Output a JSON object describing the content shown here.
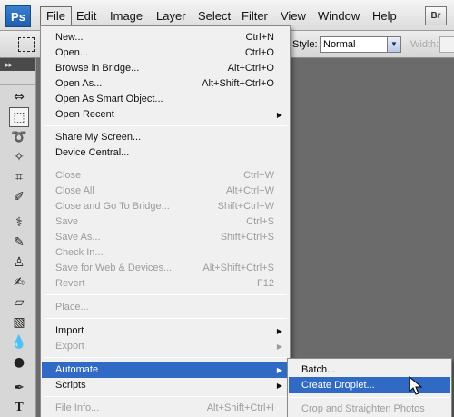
{
  "app": {
    "logo": "Ps",
    "bridge_logo": "Br"
  },
  "menubar": {
    "items": [
      "File",
      "Edit",
      "Image",
      "Layer",
      "Select",
      "Filter",
      "View",
      "Window",
      "Help"
    ]
  },
  "options": {
    "style_label": "Style:",
    "style_value": "Normal",
    "width_label": "Width:"
  },
  "file_menu": {
    "new": {
      "label": "New...",
      "shortcut": "Ctrl+N"
    },
    "open": {
      "label": "Open...",
      "shortcut": "Ctrl+O"
    },
    "browse": {
      "label": "Browse in Bridge...",
      "shortcut": "Alt+Ctrl+O"
    },
    "open_as": {
      "label": "Open As...",
      "shortcut": "Alt+Shift+Ctrl+O"
    },
    "open_smart": {
      "label": "Open As Smart Object..."
    },
    "open_recent": {
      "label": "Open Recent"
    },
    "share": {
      "label": "Share My Screen..."
    },
    "device_central": {
      "label": "Device Central..."
    },
    "close": {
      "label": "Close",
      "shortcut": "Ctrl+W"
    },
    "close_all": {
      "label": "Close All",
      "shortcut": "Alt+Ctrl+W"
    },
    "close_bridge": {
      "label": "Close and Go To Bridge...",
      "shortcut": "Shift+Ctrl+W"
    },
    "save": {
      "label": "Save",
      "shortcut": "Ctrl+S"
    },
    "save_as": {
      "label": "Save As...",
      "shortcut": "Shift+Ctrl+S"
    },
    "check_in": {
      "label": "Check In..."
    },
    "save_web": {
      "label": "Save for Web & Devices...",
      "shortcut": "Alt+Shift+Ctrl+S"
    },
    "revert": {
      "label": "Revert",
      "shortcut": "F12"
    },
    "place": {
      "label": "Place..."
    },
    "import": {
      "label": "Import"
    },
    "export": {
      "label": "Export"
    },
    "automate": {
      "label": "Automate"
    },
    "scripts": {
      "label": "Scripts"
    },
    "file_info": {
      "label": "File Info...",
      "shortcut": "Alt+Shift+Ctrl+I"
    }
  },
  "automate_submenu": {
    "batch": "Batch...",
    "create_droplet": "Create Droplet...",
    "crop_straighten": "Crop and Straighten Photos"
  },
  "icons": {
    "arrow": "submenu-arrow",
    "cursor": "mouse-pointer"
  }
}
